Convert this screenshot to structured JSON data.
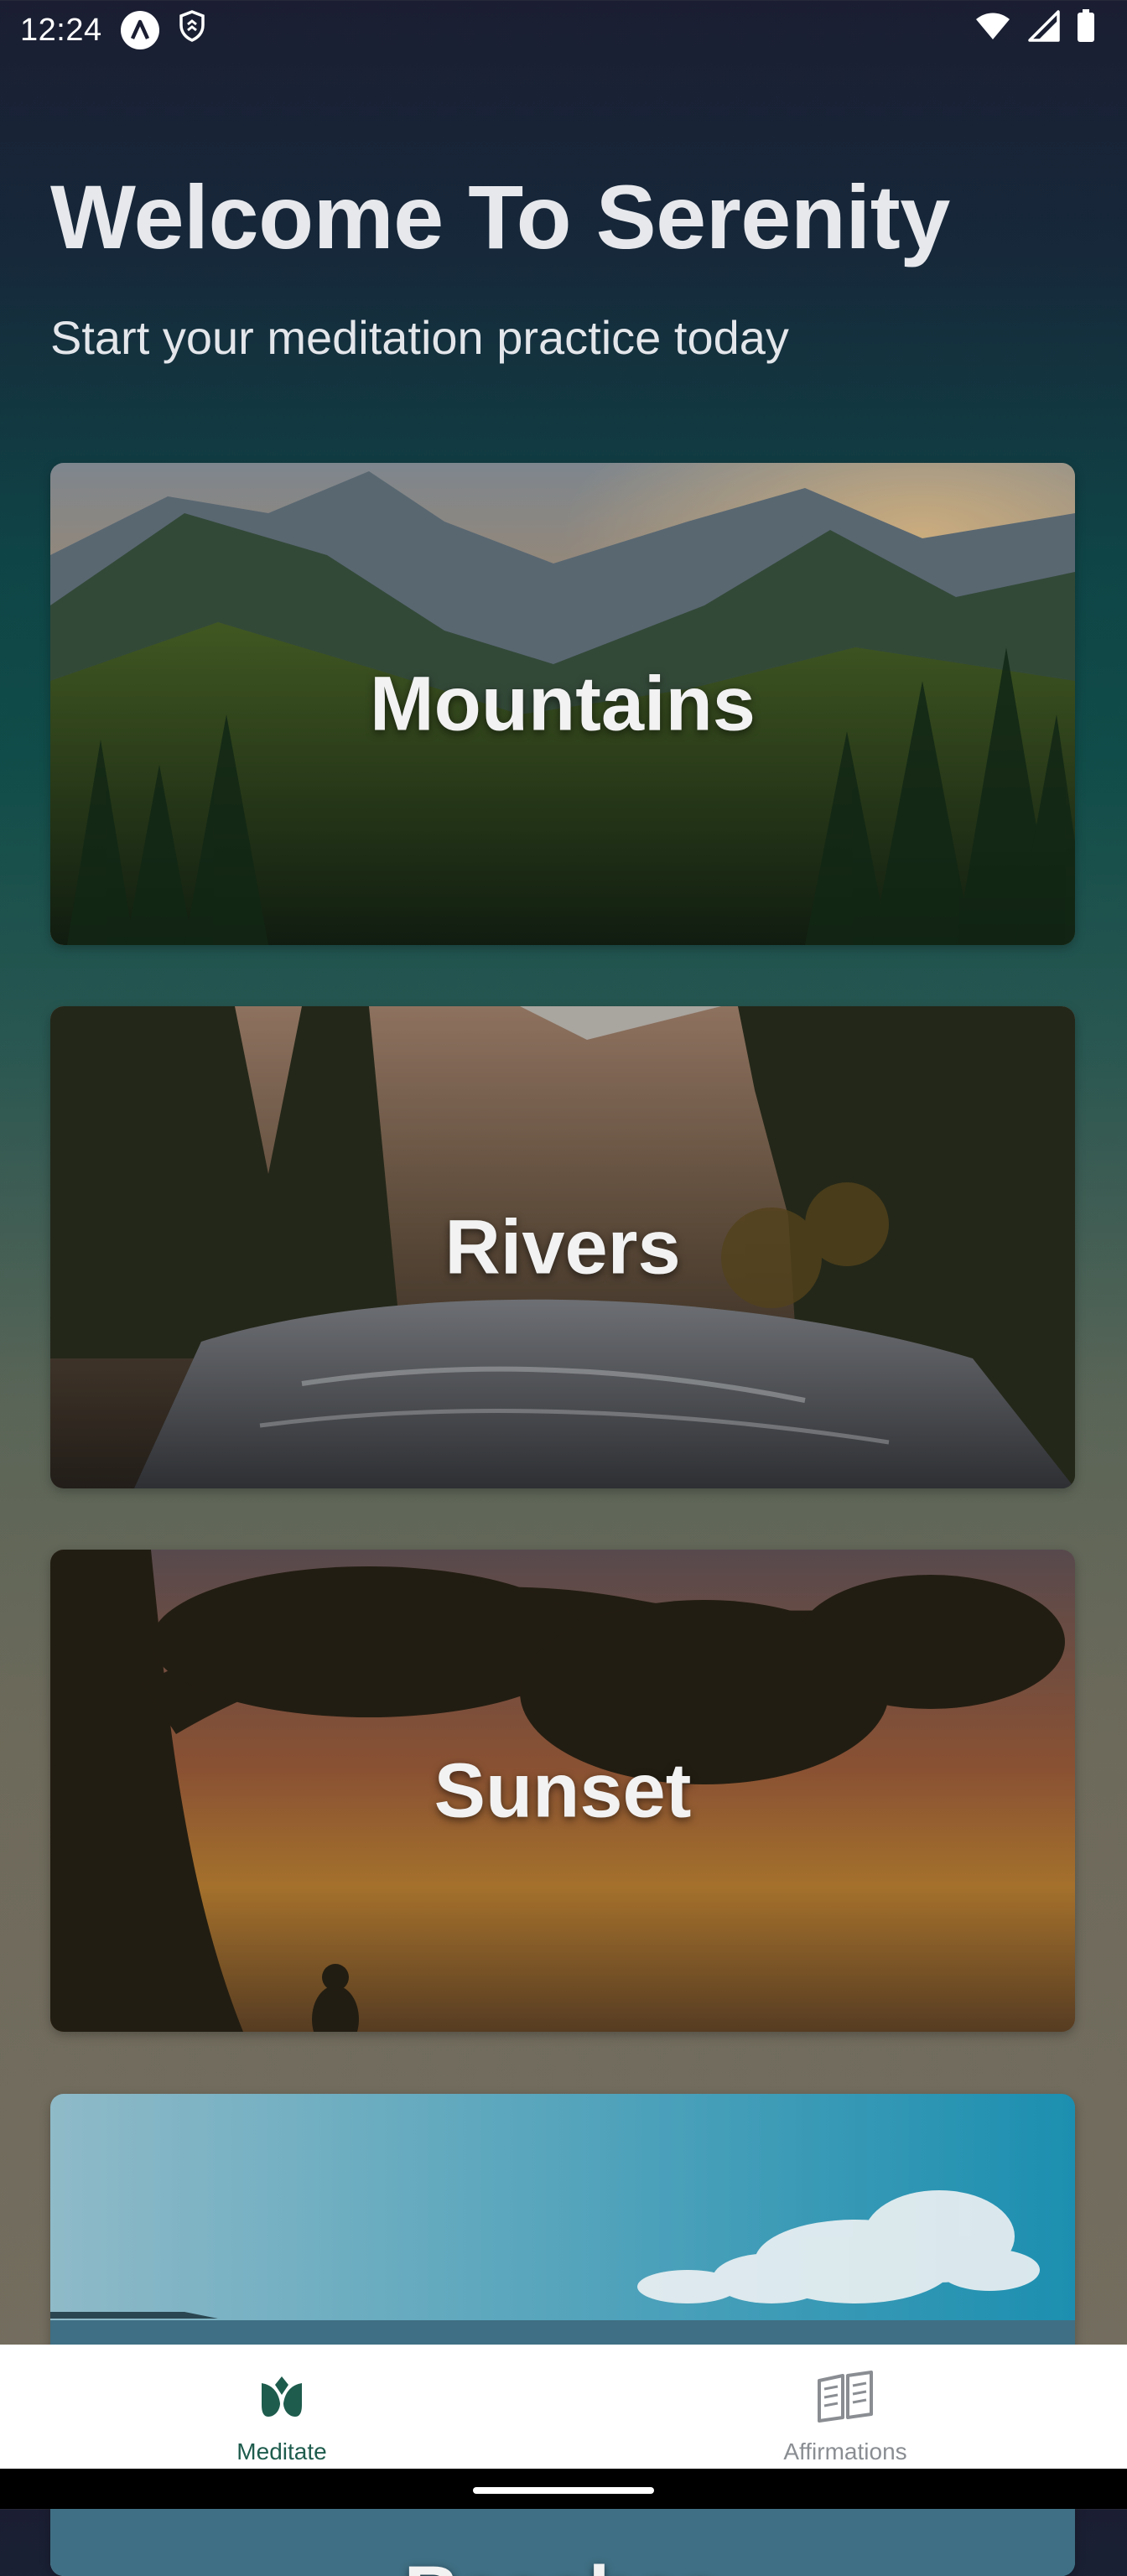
{
  "status_bar": {
    "time": "12:24",
    "icons": [
      "a-badge-icon",
      "security-icon",
      "wifi-icon",
      "signal-icon",
      "battery-icon"
    ]
  },
  "header": {
    "title": "Welcome To Serenity",
    "subtitle": "Start your meditation practice today"
  },
  "cards": [
    {
      "label": "Mountains"
    },
    {
      "label": "Rivers"
    },
    {
      "label": "Sunset"
    },
    {
      "label": "Beaches"
    }
  ],
  "bottom_nav": {
    "items": [
      {
        "label": "Meditate",
        "icon": "lotus-icon",
        "active": true
      },
      {
        "label": "Affirmations",
        "icon": "book-icon",
        "active": false
      }
    ]
  },
  "colors": {
    "nav_active": "#1e5c4d",
    "nav_inactive": "#8a8e93"
  }
}
